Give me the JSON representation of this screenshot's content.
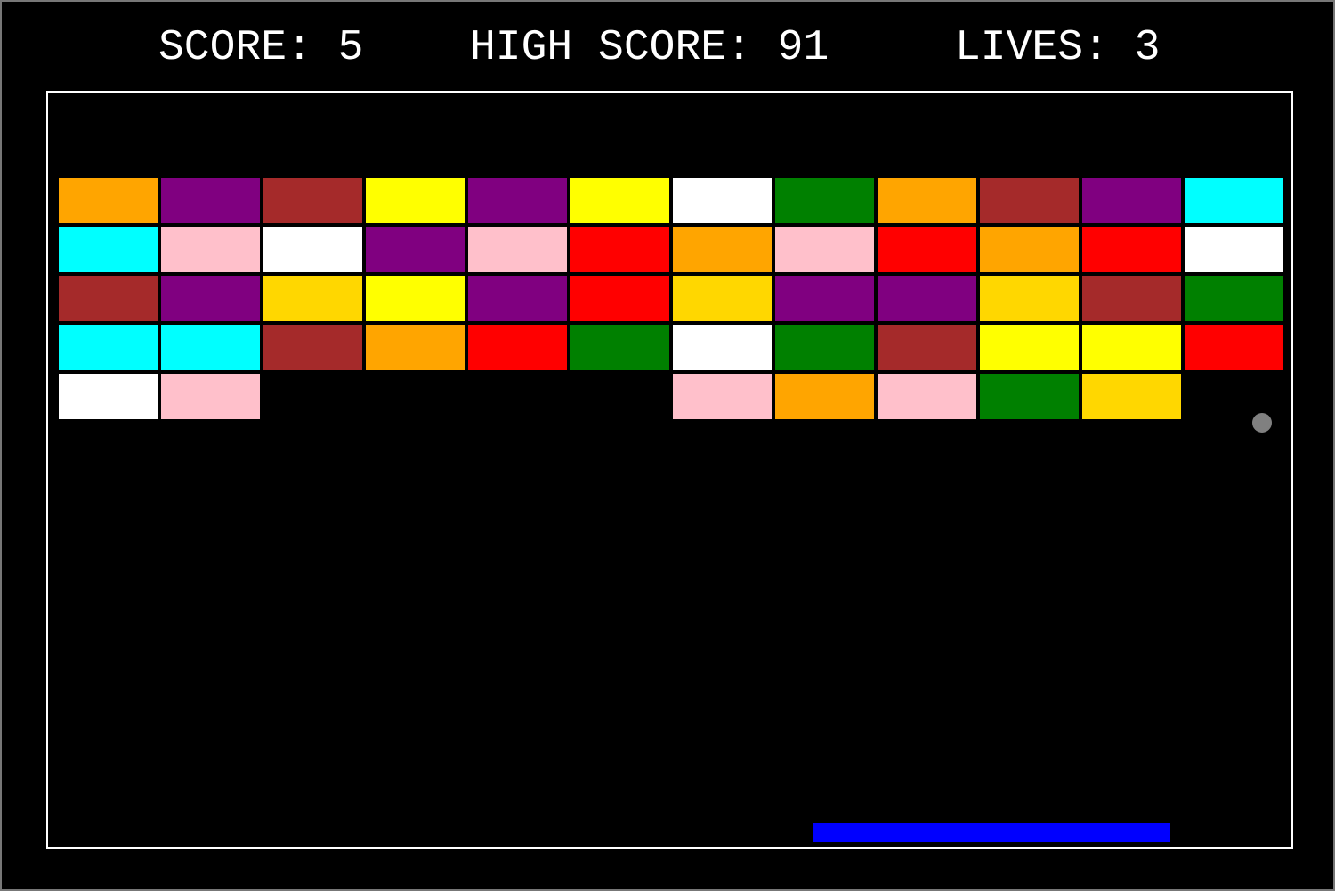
{
  "hud": {
    "score_label": "SCORE:",
    "score_value": "5",
    "high_score_label": "HIGH SCORE:",
    "high_score_value": "91",
    "lives_label": "LIVES:",
    "lives_value": "3"
  },
  "colors": {
    "background": "#000000",
    "frame": "#ffffff",
    "paddle": "#0000ff",
    "ball": "#808080",
    "text": "#ffffff"
  },
  "bricks": {
    "columns": 12,
    "rows": [
      [
        "orange",
        "purple",
        "brown",
        "yellow",
        "purple",
        "yellow",
        "white",
        "green",
        "orange",
        "brown",
        "purple",
        "cyan"
      ],
      [
        "cyan",
        "pink",
        "white",
        "purple",
        "pink",
        "red",
        "orange",
        "pink",
        "red",
        "orange",
        "red",
        "white"
      ],
      [
        "brown",
        "purple",
        "gold",
        "yellow",
        "purple",
        "red",
        "gold",
        "purple",
        "purple",
        "gold",
        "brown",
        "green"
      ],
      [
        "cyan",
        "cyan",
        "brown",
        "orange",
        "red",
        "green",
        "white",
        "green",
        "brown",
        "yellow",
        "yellow",
        "red"
      ],
      [
        "white",
        "pink",
        null,
        null,
        null,
        null,
        "pink",
        "orange",
        "pink",
        "green",
        "gold",
        null
      ]
    ]
  },
  "palette": {
    "orange": "#ffa500",
    "purple": "#800080",
    "brown": "#a52a2a",
    "yellow": "#ffff00",
    "white": "#ffffff",
    "green": "#008000",
    "cyan": "#00ffff",
    "pink": "#ffc0cb",
    "red": "#ff0000",
    "gold": "#ffd700"
  }
}
